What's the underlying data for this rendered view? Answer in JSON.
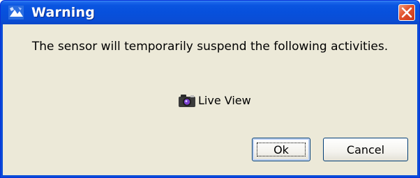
{
  "window": {
    "title": "Warning",
    "title_icon": "warning-app-icon",
    "close_icon": "close-icon"
  },
  "message": "The sensor will temporarily suspend the following activities.",
  "activities": [
    {
      "icon": "camera-icon",
      "label": "Live View"
    }
  ],
  "buttons": {
    "ok_label": "Ok",
    "cancel_label": "Cancel"
  },
  "colors": {
    "titlebar": "#0a55e0",
    "client_background": "#ece9d8",
    "close_button": "#e2512b"
  }
}
